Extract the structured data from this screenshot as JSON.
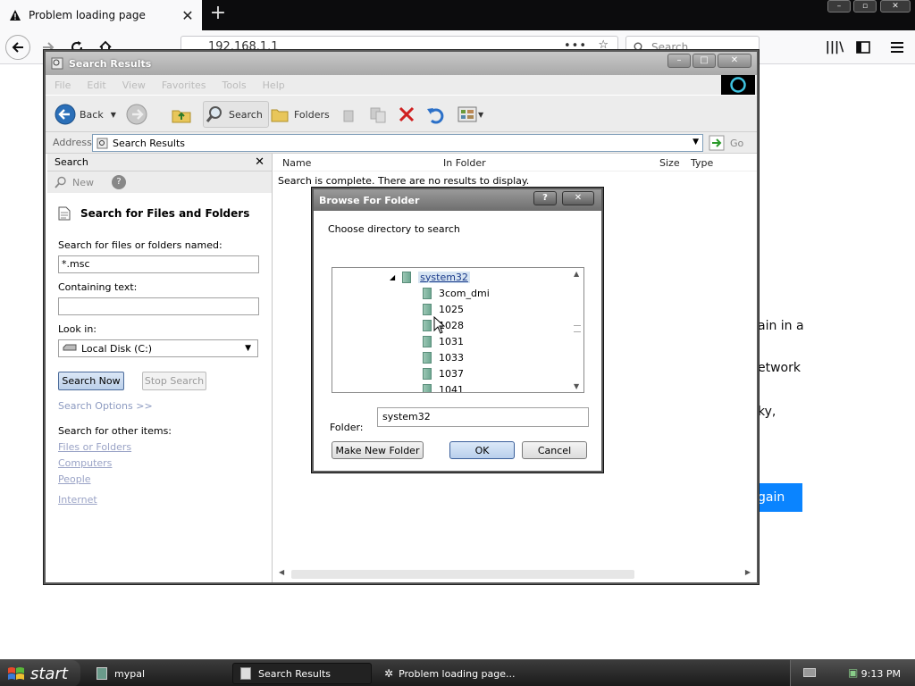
{
  "browser": {
    "tab_title": "Problem loading page",
    "url": "192.168.1.1",
    "search_placeholder": "Search",
    "content_fragments": [
      "ain in a",
      "etwork",
      "ky,"
    ],
    "try_again_label": "gain"
  },
  "explorer": {
    "title": "Search Results",
    "menu": [
      "File",
      "Edit",
      "View",
      "Favorites",
      "Tools",
      "Help"
    ],
    "toolbar": {
      "back": "Back",
      "search": "Search",
      "folders": "Folders"
    },
    "address_label": "Address",
    "address_value": "Search Results",
    "go_label": "Go",
    "search_pane": {
      "header": "Search",
      "new_label": "New",
      "heading": "Search for Files and Folders",
      "named_label": "Search for files or folders named:",
      "named_value": "*.msc",
      "containing_label": "Containing text:",
      "containing_value": "",
      "lookin_label": "Look in:",
      "lookin_value": "Local Disk (C:)",
      "search_now": "Search Now",
      "stop_search": "Stop Search",
      "search_options": "Search Options >>",
      "other_items_label": "Search for other items:",
      "other_items": [
        "Files or Folders",
        "Computers",
        "People",
        "Internet"
      ]
    },
    "results": {
      "columns": [
        "Name",
        "In Folder",
        "Size",
        "Type"
      ],
      "message": "Search is complete. There are no results to display."
    }
  },
  "dialog": {
    "title": "Browse For Folder",
    "prompt": "Choose directory to search",
    "tree_selected": "system32",
    "tree_items": [
      "3com_dmi",
      "1025",
      "1028",
      "1031",
      "1033",
      "1037",
      "1041"
    ],
    "folder_label": "Folder:",
    "folder_value": "system32",
    "make_new_folder": "Make New Folder",
    "ok": "OK",
    "cancel": "Cancel"
  },
  "taskbar": {
    "start": "start",
    "tasks": [
      "mypal",
      "Search Results",
      "Problem loading page..."
    ],
    "clock": "9:13 PM"
  }
}
